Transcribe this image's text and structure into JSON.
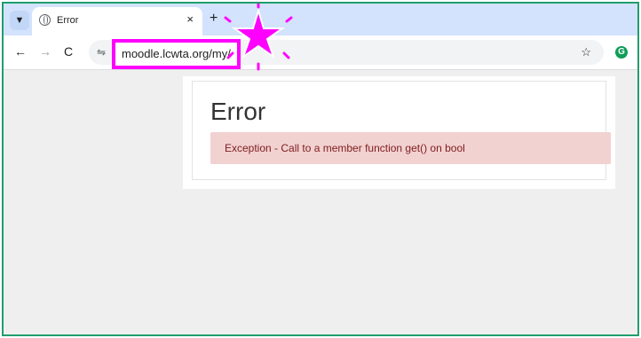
{
  "browser": {
    "tab": {
      "title": "Error",
      "close": "×"
    },
    "new_tab": "+",
    "nav": {
      "back": "←",
      "forward": "→",
      "reload": "C"
    },
    "address": {
      "url": "moodle.lcwta.org/my/",
      "site_info_icon": "⇋"
    },
    "bookmark_star": "☆",
    "extension_letter": "G",
    "highlight_color": "#ff00ff"
  },
  "page": {
    "heading": "Error",
    "message": "Exception - Call to a member function get() on bool"
  }
}
